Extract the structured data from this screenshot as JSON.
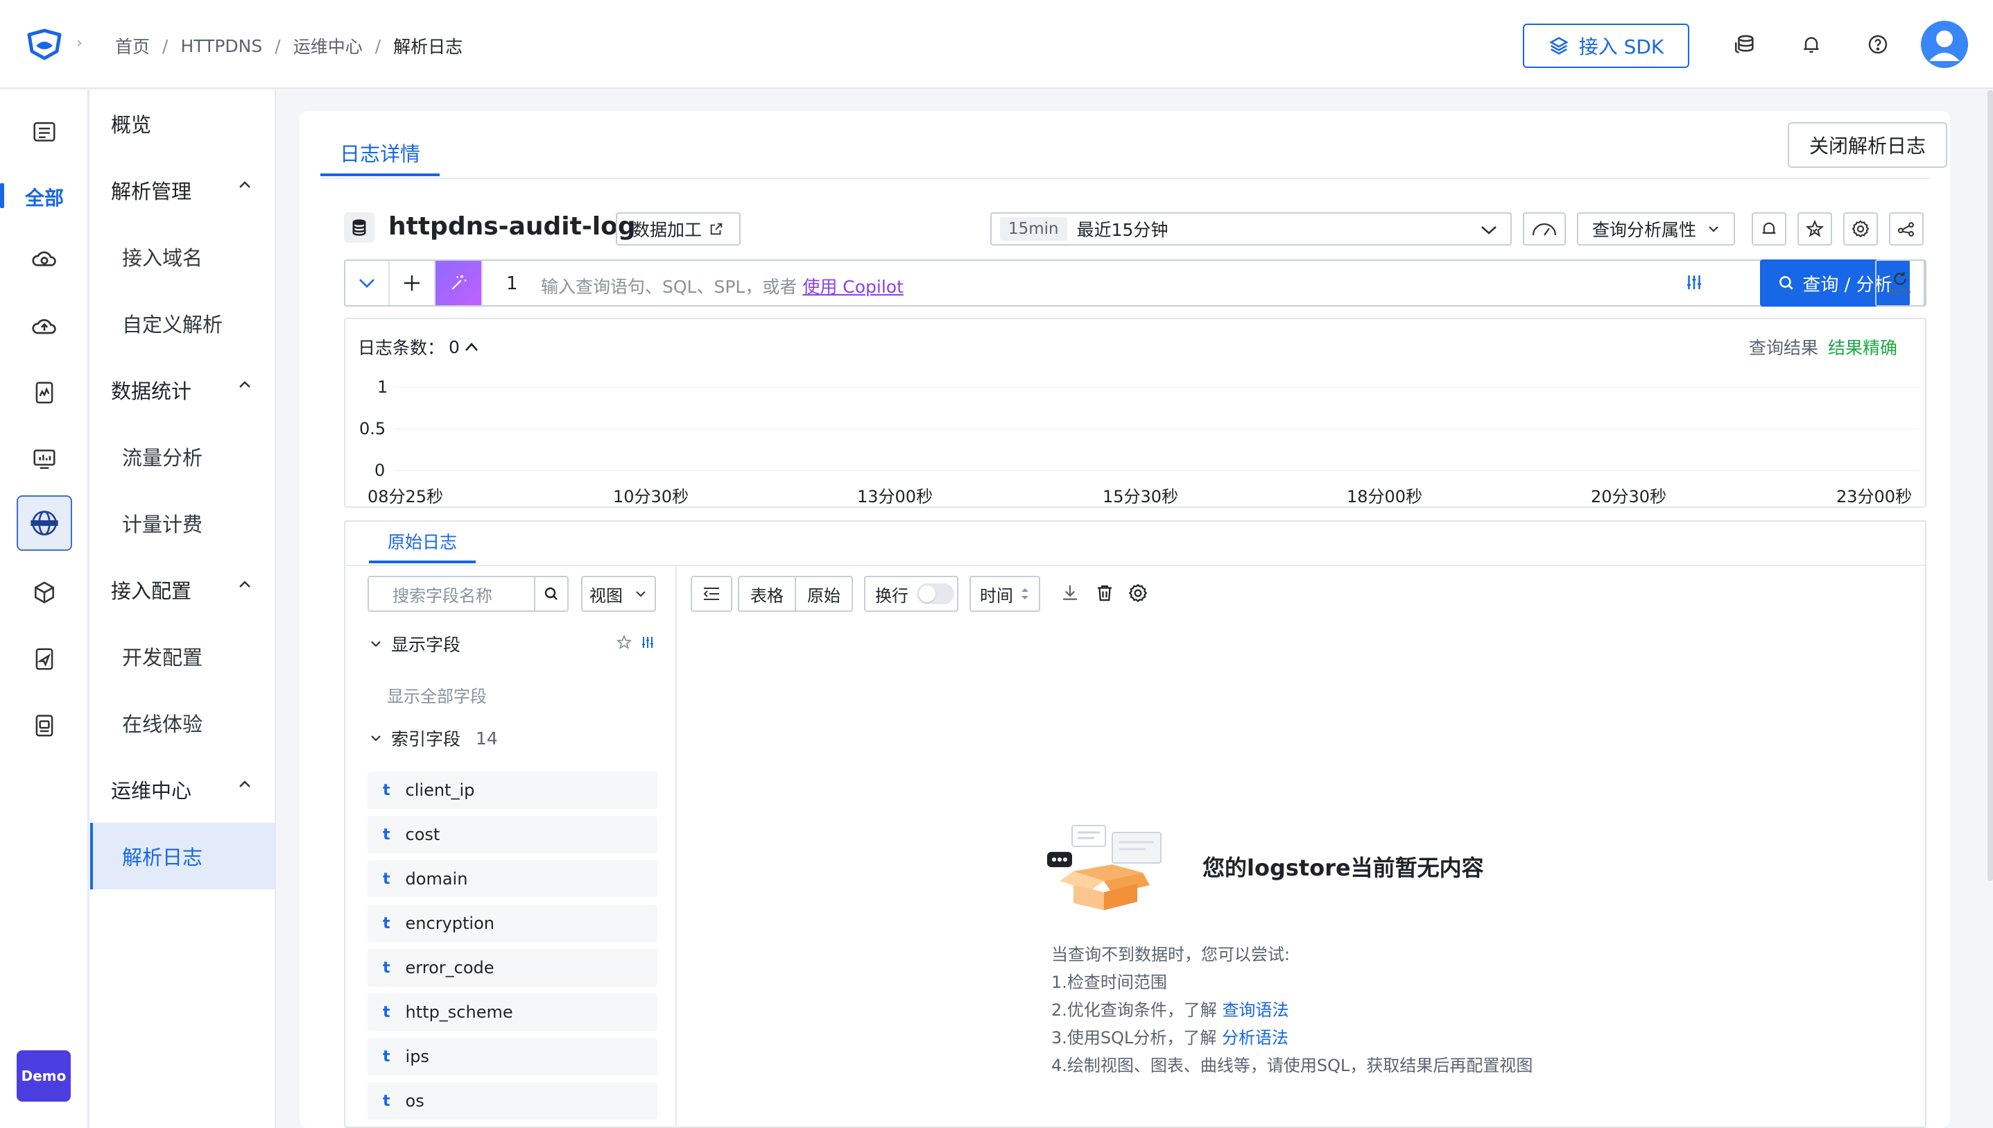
{
  "breadcrumb": {
    "home": "首页",
    "product": "HTTPDNS",
    "section": "运维中心",
    "current": "解析日志",
    "sep": "/"
  },
  "header": {
    "sdk_button": "接入 SDK",
    "icons": [
      "stack-icon",
      "bell-icon",
      "help-icon",
      "avatar"
    ]
  },
  "rail": {
    "all_label": "全部",
    "demo_label": "Demo"
  },
  "nav": {
    "overview": "概览",
    "group_resolve": "解析管理",
    "item_domain": "接入域名",
    "item_custom": "自定义解析",
    "group_stats": "数据统计",
    "item_traffic": "流量分析",
    "item_billing": "计量计费",
    "group_config": "接入配置",
    "item_dev": "开发配置",
    "item_online": "在线体验",
    "group_ops": "运维中心",
    "item_logs": "解析日志"
  },
  "card": {
    "tab_detail": "日志详情",
    "close_button": "关闭解析日志",
    "logstore_name": "httpdns-audit-log",
    "data_process_button": "数据加工",
    "time_tag": "15min",
    "time_label": "最近15分钟",
    "query_props_button": "查询分析属性"
  },
  "query": {
    "line_no": "1",
    "placeholder": "输入查询语句、SQL、SPL，或者",
    "copilot_link": "使用 Copilot",
    "search_button": "查询 / 分析",
    "auto_label": "AUTO"
  },
  "histogram": {
    "count_label": "日志条数：",
    "count_value": "0",
    "result_label": "查询结果",
    "exact_label": "结果精确",
    "y_ticks": [
      "1",
      "0.5",
      "0"
    ],
    "x_ticks": [
      "08分25秒",
      "10分30秒",
      "13分00秒",
      "15分30秒",
      "18分00秒",
      "20分30秒",
      "23分00秒"
    ]
  },
  "results": {
    "raw_tab": "原始日志",
    "field_search_placeholder": "搜索字段名称",
    "view_select": "视图",
    "show_fields": "显示字段",
    "show_all": "显示全部字段",
    "index_fields": "索引字段",
    "index_count": "14",
    "fields": [
      {
        "type": "t",
        "name": "client_ip"
      },
      {
        "type": "t",
        "name": "cost"
      },
      {
        "type": "t",
        "name": "domain"
      },
      {
        "type": "t",
        "name": "encryption"
      },
      {
        "type": "t",
        "name": "error_code"
      },
      {
        "type": "t",
        "name": "http_scheme"
      },
      {
        "type": "t",
        "name": "ips"
      },
      {
        "type": "t",
        "name": "os"
      }
    ],
    "toolbar": {
      "table": "表格",
      "raw": "原始",
      "wrap": "换行",
      "time": "时间"
    },
    "empty": {
      "title": "您的logstore当前暂无内容",
      "hint": "当查询不到数据时，您可以尝试:",
      "tip1": "1.检查时间范围",
      "tip2": "2.优化查询条件，了解",
      "tip2_link": "查询语法",
      "tip3": "3.使用SQL分析，了解",
      "tip3_link": "分析语法",
      "tip4": "4.绘制视图、图表、曲线等，请使用SQL，获取结果后再配置视图"
    }
  },
  "colors": {
    "primary": "#1767e6",
    "success": "#1ea844",
    "copilot": "#8a3ff0",
    "demo": "#4b3ee0"
  }
}
